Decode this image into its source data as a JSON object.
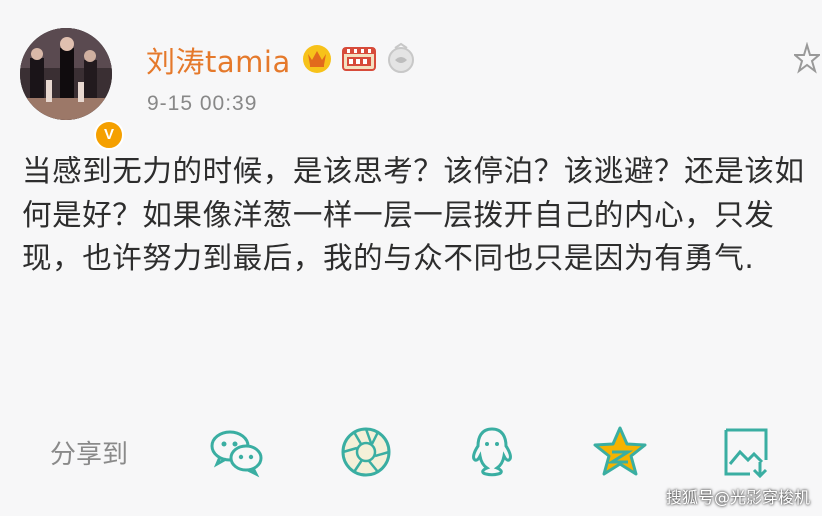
{
  "post": {
    "author": "刘涛tamia",
    "timestamp": "9-15 00:39",
    "verified_badge": "V",
    "text": "当感到无力的时候，是该思考？该停泊？该逃避？还是该如何是好？如果像洋葱一样一层一层拨开自己的内心，只发现，也许努力到最后，我的与众不同也只是因为有勇气."
  },
  "badges": [
    "crown-badge-icon",
    "movie-badge-icon",
    "level-badge-icon"
  ],
  "share": {
    "label": "分享到",
    "targets": [
      "wechat-icon",
      "moments-icon",
      "qq-icon",
      "qzone-icon",
      "save-image-icon"
    ]
  },
  "watermark": "搜狐号@光影穿梭机",
  "colors": {
    "username": "#e5792b",
    "share_icon": "#3aaea2",
    "accent_yellow": "#f5b300",
    "text": "#2d2d2d"
  }
}
